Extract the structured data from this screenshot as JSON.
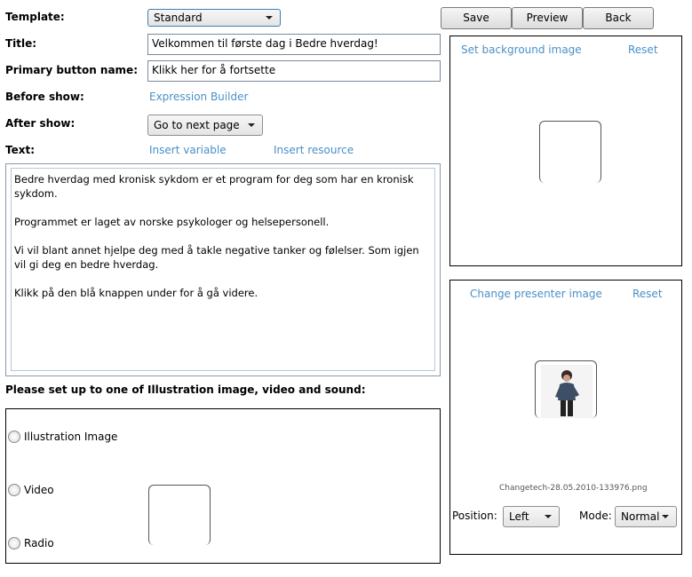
{
  "labels": {
    "template": "Template:",
    "title": "Title:",
    "primary_button_name": "Primary button name:",
    "before_show": "Before show:",
    "after_show": "After show:",
    "text": "Text:",
    "media_heading": "Please set up to one of Illustration image, video and sound:"
  },
  "template_select": {
    "value": "Standard"
  },
  "title_input": {
    "value": "Velkommen til første dag i Bedre hverdag!"
  },
  "primary_button_input": {
    "value": "Klikk her for å fortsette"
  },
  "before_show_link": "Expression Builder",
  "after_show_select": {
    "value": "Go to next page"
  },
  "text_links": {
    "insert_variable": "Insert variable",
    "insert_resource": "Insert resource"
  },
  "text_content": {
    "p1": "Bedre hverdag med kronisk sykdom er et program for deg som har en kronisk sykdom.",
    "p2": "Programmet er laget av norske psykologer og helsepersonell.",
    "p3": "Vi vil blant annet hjelpe deg med å takle negative tanker og følelser. Som igjen vil gi deg en bedre hverdag.",
    "p4": "Klikk på den blå knappen under for å gå videre."
  },
  "media_options": {
    "illustration": "Illustration Image",
    "video": "Video",
    "radio": "Radio"
  },
  "toolbar": {
    "save": "Save",
    "preview": "Preview",
    "back": "Back"
  },
  "background_panel": {
    "set_link": "Set background image",
    "reset_link": "Reset"
  },
  "presenter_panel": {
    "change_link": "Change presenter image",
    "reset_link": "Reset",
    "filename": "Changetech-28.05.2010-133976.png",
    "position_label": "Position:",
    "position_value": "Left",
    "mode_label": "Mode:",
    "mode_value": "Normal"
  }
}
